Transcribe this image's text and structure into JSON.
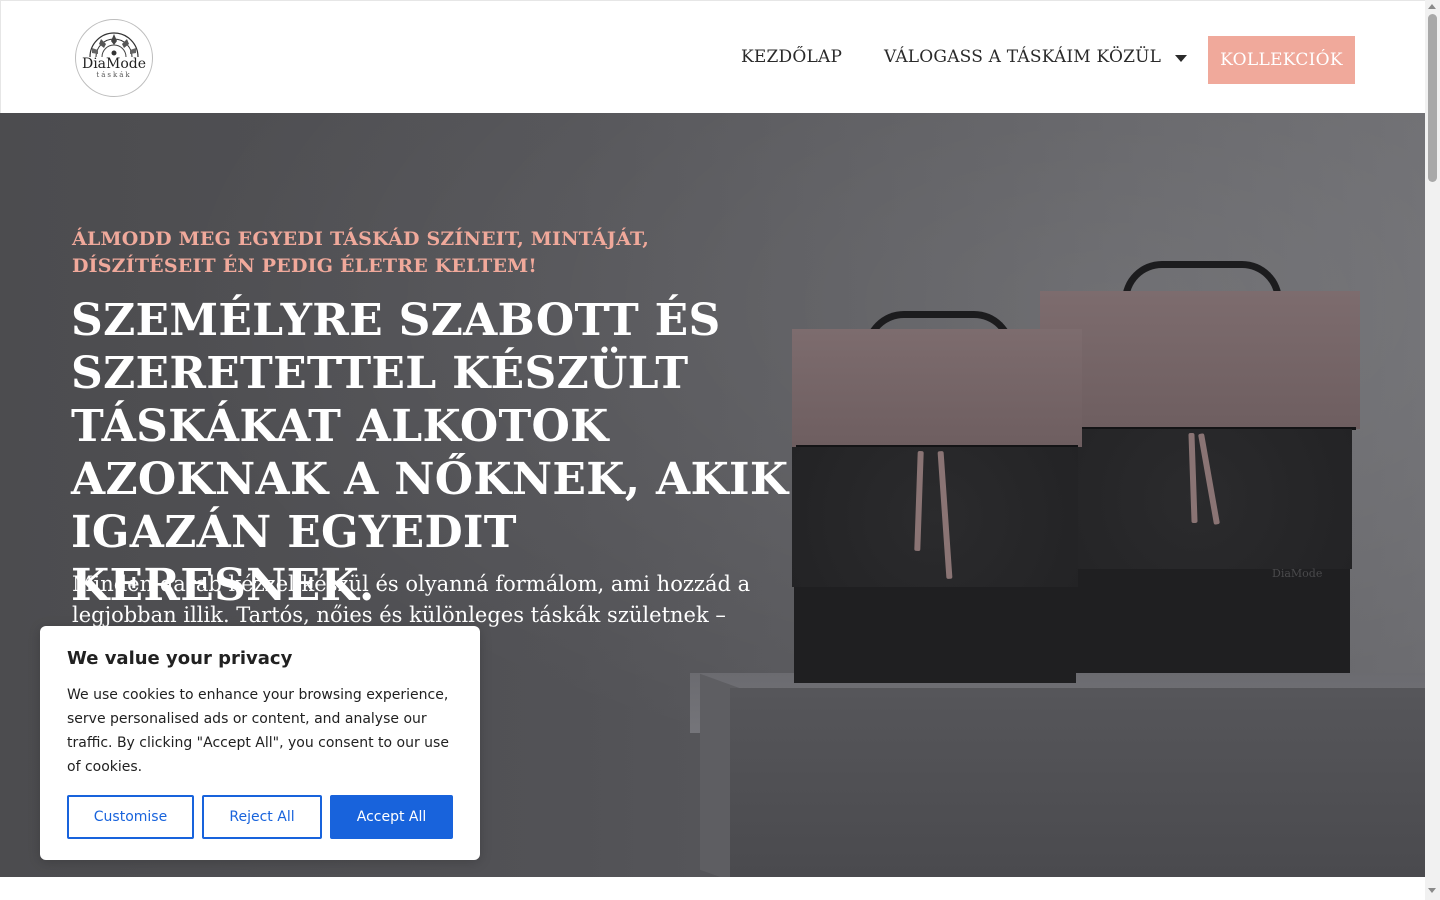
{
  "header": {
    "logo": {
      "name": "DiaMode",
      "sub": "táskák"
    },
    "nav": {
      "home": "KEZDŐLAP",
      "browse": "VÁLOGASS A TÁSKÁIM KÖZÜL",
      "cta": "KOLLEKCIÓK"
    }
  },
  "hero": {
    "kicker": "ÁLMODD MEG EGYEDI TÁSKÁD SZÍNEIT, MINTÁJÁT, DÍSZÍTÉSEIT ÉN PEDIG ÉLETRE KELTEM!",
    "title": "SZEMÉLYRE SZABOTT ÉS SZERETETTEL KÉSZÜLT TÁSKÁKAT ALKOTOK AZOKNAK A NŐKNEK, AKIK IGAZÁN EGYEDIT KERESNEK.",
    "description": "Minden darab kézzel készül és olyanná formálom, ami hozzád a legjobban illik. Tartós, nőies és különleges táskák születnek – csak",
    "bag_brand": "DiaMode"
  },
  "cookie_banner": {
    "title": "We value your privacy",
    "text": "We use cookies to enhance your browsing experience, serve personalised ads or content, and analyse our traffic. By clicking \"Accept All\", you consent to our use of cookies.",
    "customise": "Customise",
    "reject": "Reject All",
    "accept": "Accept All"
  },
  "colors": {
    "accent": "#f0a99b",
    "cookie_primary": "#1863dc",
    "hero_overlay": "#525256"
  }
}
